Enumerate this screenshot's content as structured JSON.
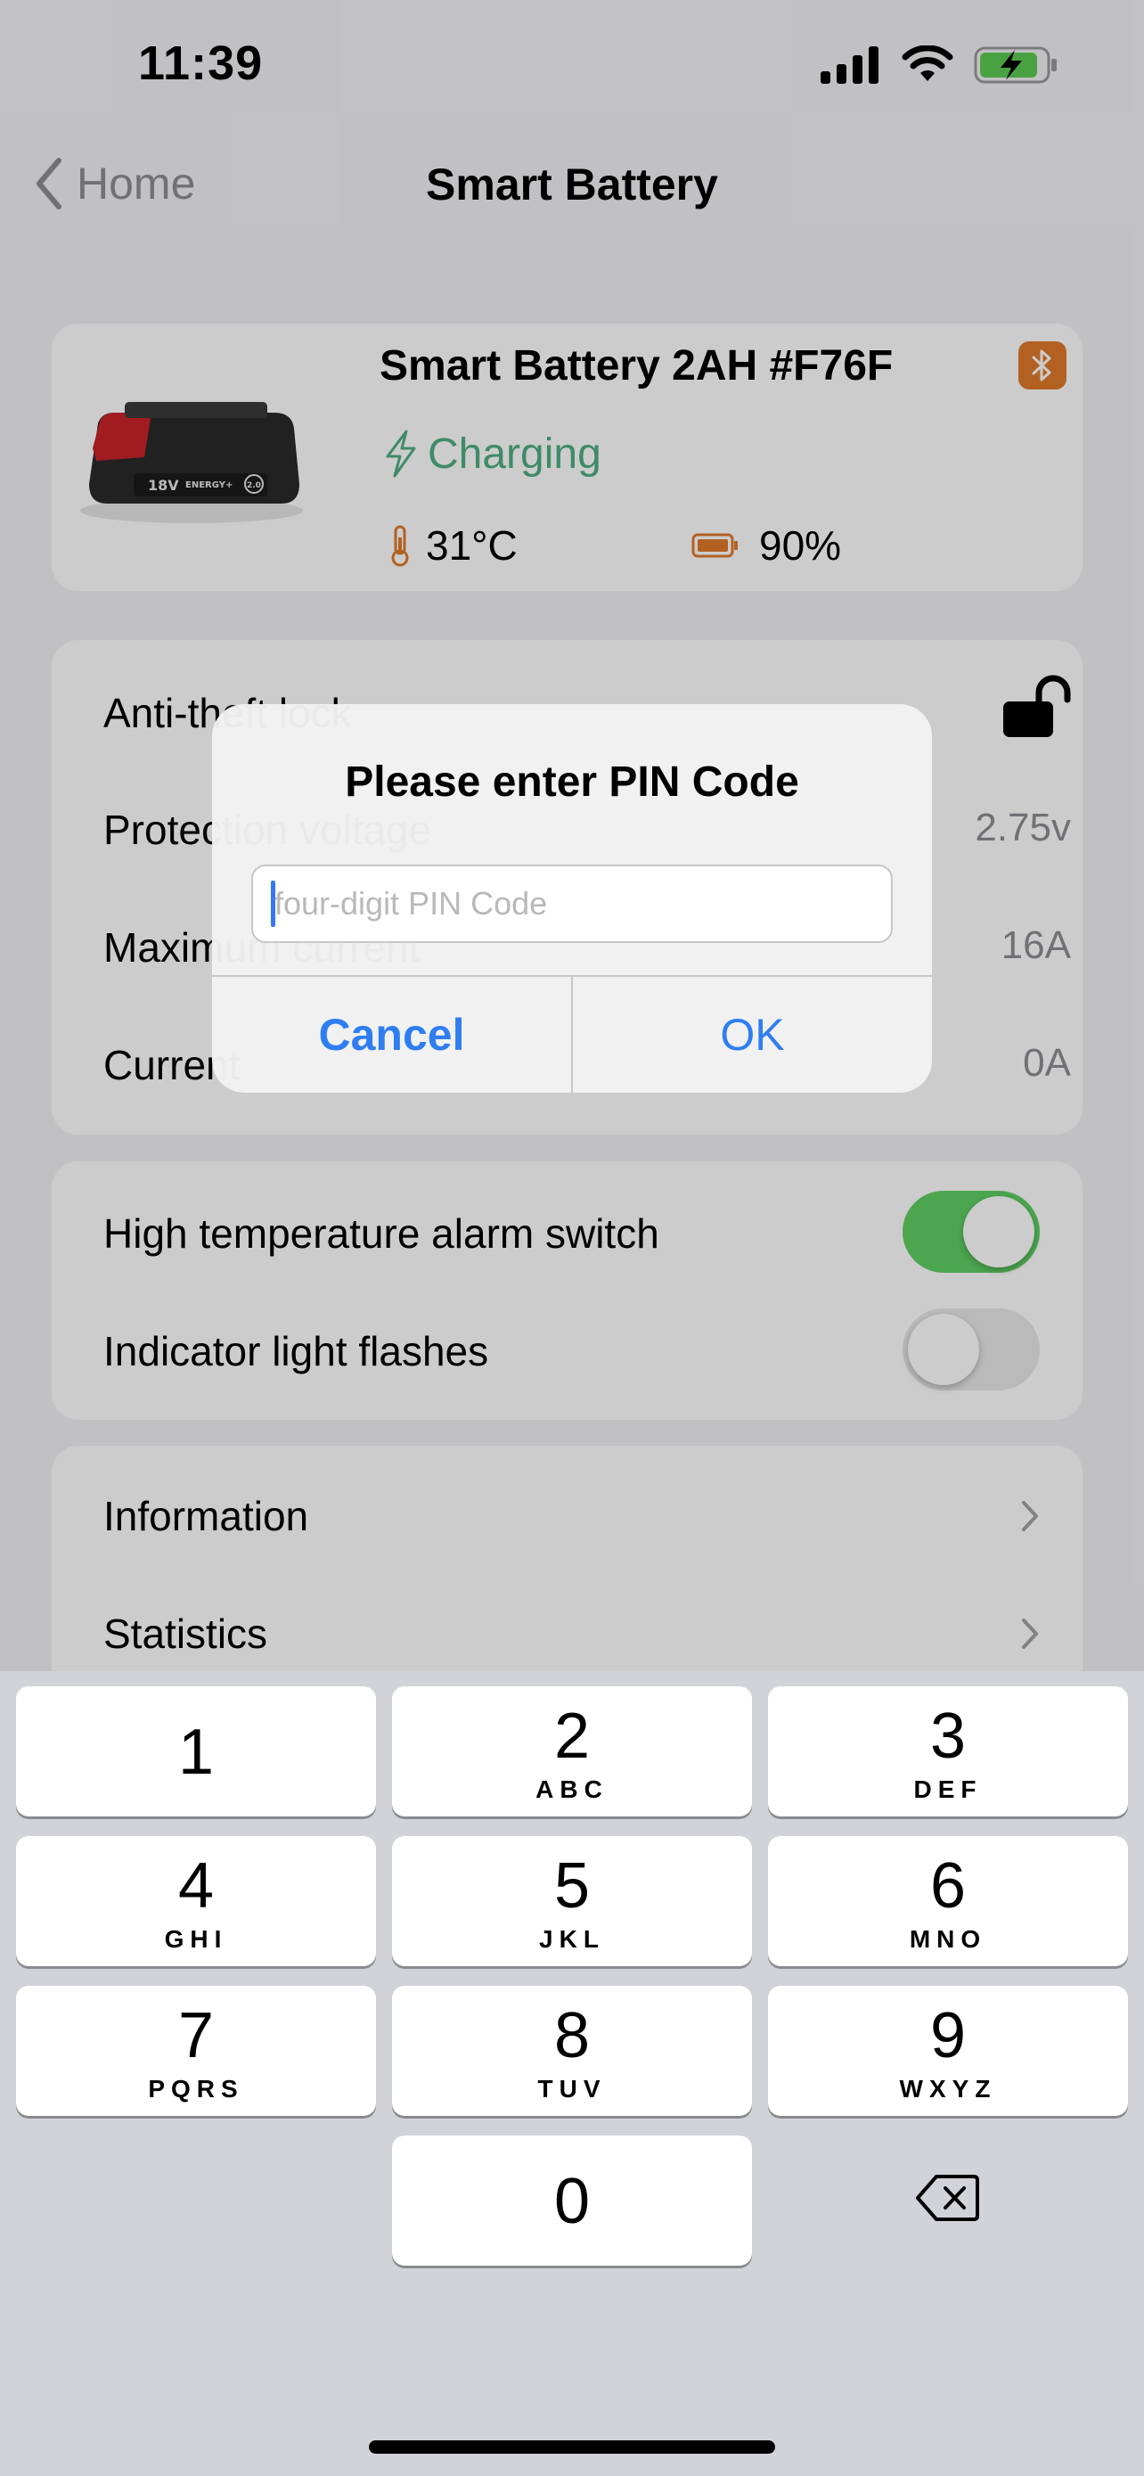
{
  "status_bar": {
    "time": "11:39"
  },
  "nav": {
    "back_label": "Home",
    "title": "Smart Battery"
  },
  "device": {
    "name": "Smart Battery 2AH #F76F",
    "status": "Charging",
    "temperature": "31°C",
    "battery_percent": "90%",
    "image_labels": {
      "voltage": "18V",
      "brand": "ENERGY+",
      "capacity": "2.0"
    },
    "colors": {
      "charging": "#4fae83",
      "bluetooth_badge": "#e07a2c"
    }
  },
  "settings": {
    "anti_theft": {
      "label": "Anti-theft lock",
      "state": "unlocked"
    },
    "protection": {
      "label": "Protection voltage",
      "value": "2.75v"
    },
    "max_current": {
      "label": "Maximum current",
      "value": "16A"
    },
    "current": {
      "label": "Current",
      "value": "0A"
    }
  },
  "toggles": {
    "high_temp": {
      "label": "High temperature alarm switch",
      "on": true
    },
    "indicator": {
      "label": "Indicator light flashes",
      "on": false
    }
  },
  "links": [
    {
      "label": "Information"
    },
    {
      "label": "Statistics"
    }
  ],
  "dialog": {
    "title": "Please enter PIN Code",
    "input_placeholder": "four-digit PIN Code",
    "input_value": "",
    "cancel_label": "Cancel",
    "ok_label": "OK",
    "accent_color": "#2f7ef1"
  },
  "keypad": {
    "keys": [
      {
        "digit": "1",
        "letters": ""
      },
      {
        "digit": "2",
        "letters": "ABC"
      },
      {
        "digit": "3",
        "letters": "DEF"
      },
      {
        "digit": "4",
        "letters": "GHI"
      },
      {
        "digit": "5",
        "letters": "JKL"
      },
      {
        "digit": "6",
        "letters": "MNO"
      },
      {
        "digit": "7",
        "letters": "PQRS"
      },
      {
        "digit": "8",
        "letters": "TUV"
      },
      {
        "digit": "9",
        "letters": "WXYZ"
      },
      {
        "digit": "0",
        "letters": ""
      }
    ],
    "delete_icon": "delete-backward-icon"
  }
}
